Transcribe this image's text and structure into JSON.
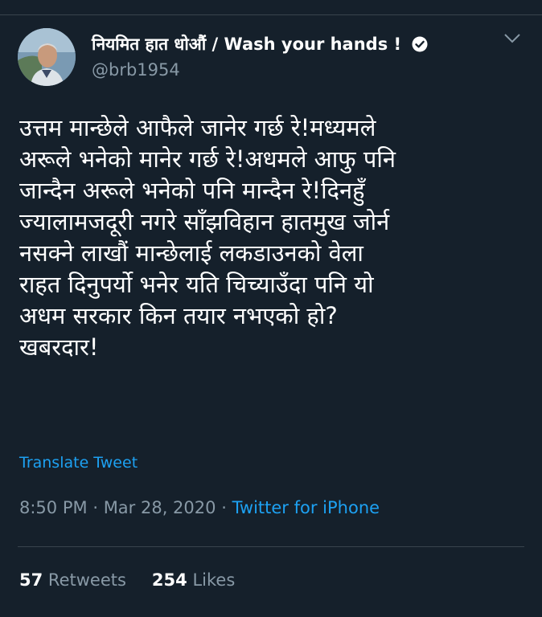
{
  "tweet": {
    "author": {
      "display_name": "नियमित हात धोऔं / Wash your hands !",
      "handle": "@brb1954",
      "verified": true,
      "avatar_icon": "profile-photo"
    },
    "text": "उत्तम मान्छेले आफैले जानेर गर्छ रे!मध्यमले\nअरूले भनेको मानेर गर्छ रे!अधमले आफु पनि\nजान्दैन अरूले भनेको पनि मान्दैन रे!दिनहुँ\nज्यालामजदूरी नगरे साँझविहान हातमुख जोर्न\nनसक्ने लाखौं मान्छेलाई लकडाउनको वेला\nराहत दिनुपर्यो भनेर यति चिच्याउँदा पनि यो\nअधम सरकार किन तयार नभएको हो?\nखबरदार!",
    "translate_label": "Translate Tweet",
    "time": "8:50 PM",
    "date": "Mar 28, 2020",
    "separator": "·",
    "source": "Twitter for iPhone",
    "retweets_count": "57",
    "retweets_label": "Retweets",
    "likes_count": "254",
    "likes_label": "Likes"
  },
  "colors": {
    "background": "#15202b",
    "accent": "#1da1f2",
    "muted": "#8899a6",
    "divider": "#38444d"
  }
}
